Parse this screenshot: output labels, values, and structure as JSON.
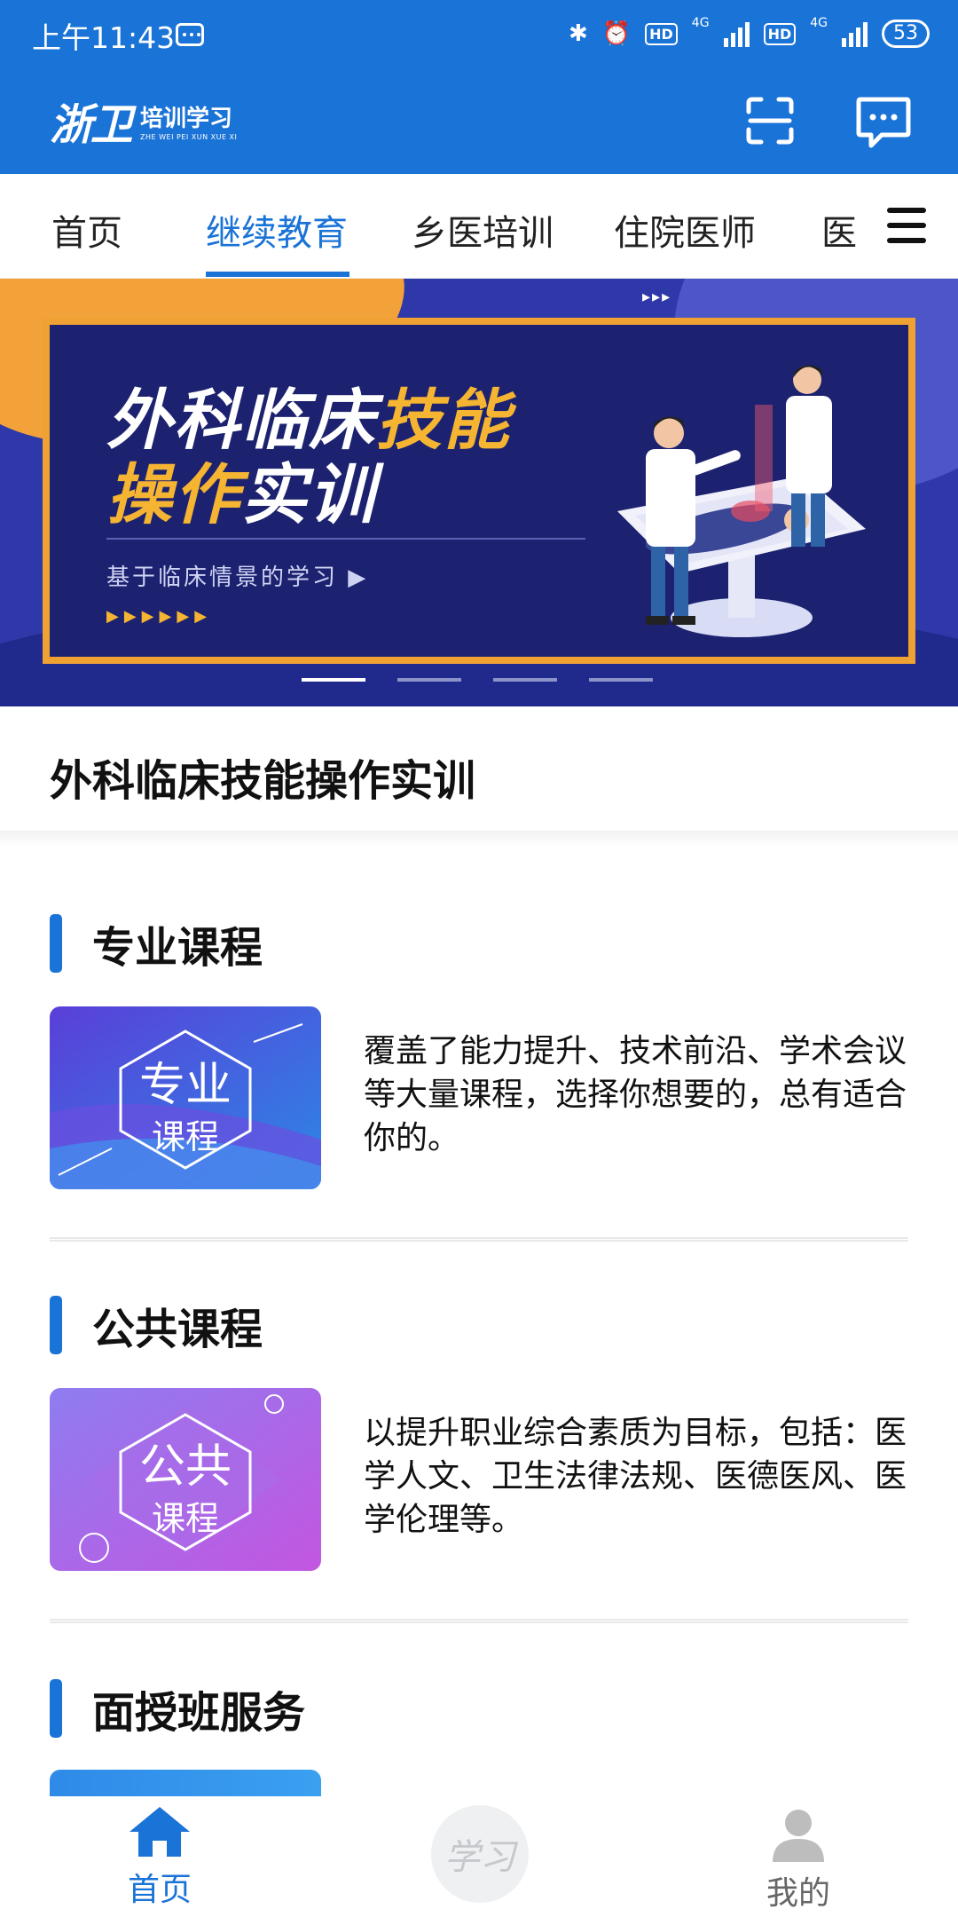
{
  "status_bar": {
    "time": "上午11:43",
    "net1": "4G",
    "net2": "4G",
    "hd": "HD",
    "battery": "53"
  },
  "app_bar": {
    "logo_main": "浙卫",
    "logo_cn": "培训学习",
    "logo_en": "ZHE WEI PEI XUN XUE XI"
  },
  "tabs": [
    "首页",
    "继续教育",
    "乡医培训",
    "住院医师",
    "医"
  ],
  "active_tab": "继续教育",
  "banner": {
    "line1_a": "外科临床",
    "line1_b": "技能",
    "line2_a": "操作",
    "line2_b": "实训",
    "subtitle": "基于临床情景的学习",
    "arrows": "▶▶▶▶▶▶",
    "arrows_top": "▸▸▸",
    "slides": 4,
    "active_slide": 1
  },
  "course_title": "外科临床技能操作实训",
  "sections": [
    {
      "title": "专业课程",
      "thumb_l1": "专业",
      "thumb_l2": "课程",
      "description": "覆盖了能力提升、技术前沿、学术会议等大量课程，选择你想要的，总有适合你的。"
    },
    {
      "title": "公共课程",
      "thumb_l1": "公共",
      "thumb_l2": "课程",
      "description": "以提升职业综合素质为目标，包括：医学人文、卫生法律法规、医德医风、医学伦理等。"
    },
    {
      "title": "面授班服务"
    }
  ],
  "bottom_nav": {
    "home": "首页",
    "study": "学习",
    "mine": "我的"
  },
  "colors": {
    "primary": "#1a73d6",
    "banner_orange": "#f0a134",
    "banner_navy": "#1c226f"
  }
}
